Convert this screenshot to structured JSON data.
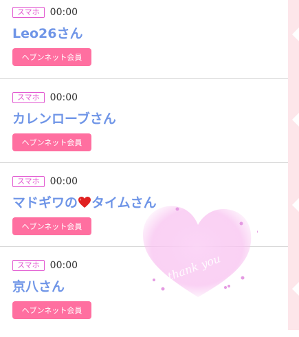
{
  "items": [
    {
      "badge": "スマホ",
      "time": "00:00",
      "name": "Leo26さん",
      "member": "ヘブンネット会員"
    },
    {
      "badge": "スマホ",
      "time": "00:00",
      "name": "カレンローブさん",
      "member": "ヘブンネット会員"
    },
    {
      "badge": "スマホ",
      "time": "00:00",
      "name": "マドギワの",
      "name_suffix": "タイムさん",
      "member": "ヘブンネット会員"
    },
    {
      "badge": "スマホ",
      "time": "00:00",
      "name": "京八さん",
      "member": "ヘブンネット会員"
    }
  ],
  "sticker": {
    "text": "thank you"
  },
  "colors": {
    "badge": "#e25ad1",
    "name": "#6f95e7",
    "member_bg": "#ff6fa0",
    "side": "#fde6ea"
  }
}
